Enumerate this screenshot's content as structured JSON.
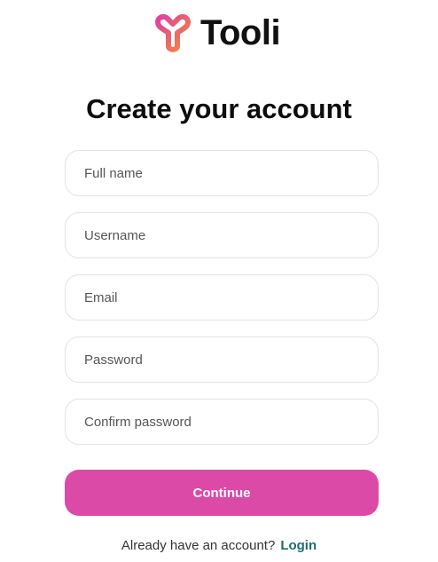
{
  "brand": {
    "name": "Tooli",
    "logo_icon": "tooli-logo-icon",
    "logo_gradient": [
      "#e040a0",
      "#f08a3c"
    ]
  },
  "form": {
    "title": "Create your account",
    "fields": {
      "full_name": {
        "placeholder": "Full name",
        "value": ""
      },
      "username": {
        "placeholder": "Username",
        "value": ""
      },
      "email": {
        "placeholder": "Email",
        "value": ""
      },
      "password": {
        "placeholder": "Password",
        "value": ""
      },
      "confirm_password": {
        "placeholder": "Confirm password",
        "value": ""
      }
    },
    "submit_label": "Continue",
    "submit_color": "#dc4aa8"
  },
  "footer": {
    "prompt": "Already have an account?",
    "login_label": "Login",
    "login_color": "#1f6b78"
  }
}
